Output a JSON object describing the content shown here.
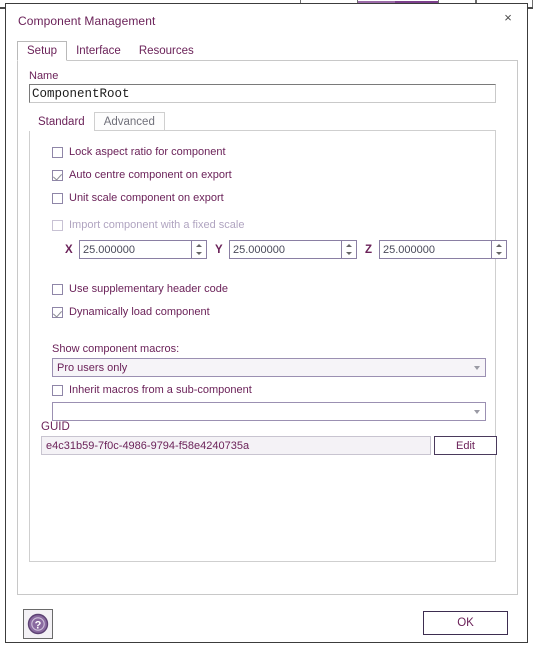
{
  "window": {
    "title": "Component Management",
    "close_label": "×"
  },
  "tabs": [
    {
      "label": "Setup",
      "active": true
    },
    {
      "label": "Interface",
      "active": false
    },
    {
      "label": "Resources",
      "active": false
    }
  ],
  "setup": {
    "name_label": "Name",
    "name_value": "ComponentRoot",
    "inner_tabs": [
      {
        "label": "Standard",
        "active": true
      },
      {
        "label": "Advanced",
        "active": false
      }
    ],
    "checkboxes": [
      {
        "label": "Lock aspect ratio for component",
        "checked": false,
        "disabled": false
      },
      {
        "label": "Auto centre component on export",
        "checked": true,
        "disabled": false
      },
      {
        "label": "Unit scale component on export",
        "checked": false,
        "disabled": false
      },
      {
        "label": "Import component with a fixed scale",
        "checked": false,
        "disabled": true
      }
    ],
    "scale": {
      "x_label": "X",
      "x_value": "25.000000",
      "y_label": "Y",
      "y_value": "25.000000",
      "z_label": "Z",
      "z_value": "25.000000"
    },
    "checkboxes2": [
      {
        "label": "Use supplementary header code",
        "checked": false,
        "disabled": false
      },
      {
        "label": "Dynamically load component",
        "checked": true,
        "disabled": false
      }
    ],
    "macros": {
      "show_label": "Show component macros:",
      "show_value": "Pro users only",
      "inherit_label": "Inherit macros from a sub-component",
      "inherit_checked": false,
      "inherit_value": ""
    },
    "guid": {
      "label": "GUID",
      "value": "e4c31b59-7f0c-4986-9794-f58e4240735a",
      "edit_label": "Edit"
    }
  },
  "footer": {
    "help_icon": "question-mark-icon",
    "ok_label": "OK"
  },
  "colors": {
    "accent": "#6b2259",
    "purple": "#5b2d82",
    "toolbar_selected": "#7c3f8c",
    "disabled_text": "#b0a4c0"
  }
}
